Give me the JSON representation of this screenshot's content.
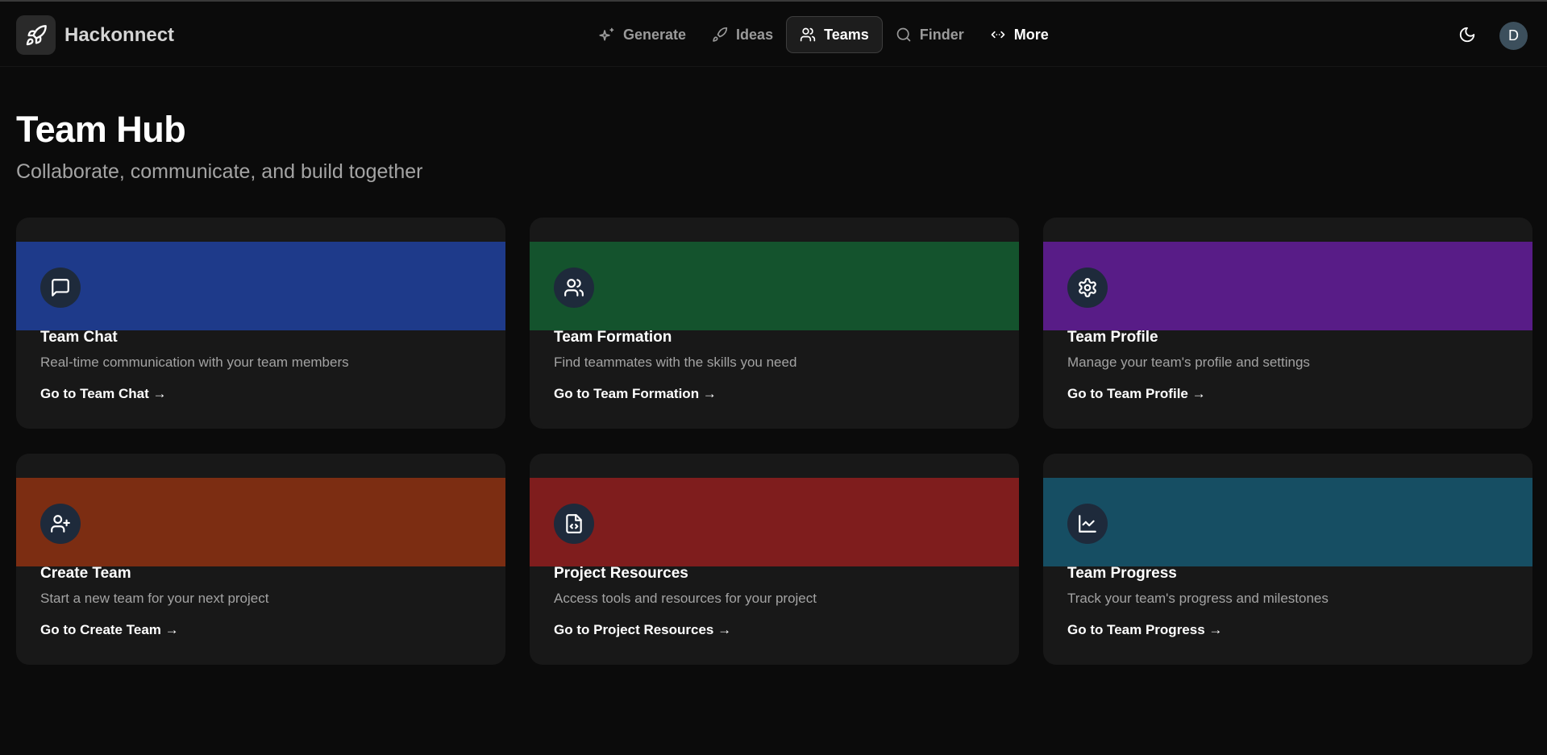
{
  "app": {
    "name": "Hackonnect"
  },
  "nav": {
    "items": [
      {
        "label": "Generate",
        "icon": "sparkles-icon"
      },
      {
        "label": "Ideas",
        "icon": "rocket-icon"
      },
      {
        "label": "Teams",
        "icon": "users-icon",
        "active": true
      },
      {
        "label": "Finder",
        "icon": "search-icon"
      },
      {
        "label": "More",
        "icon": "code-arrows-icon"
      }
    ]
  },
  "header": {
    "theme_icon": "moon-icon",
    "avatar_initial": "D"
  },
  "page": {
    "title": "Team Hub",
    "subtitle": "Collaborate, communicate, and build together"
  },
  "cards": [
    {
      "title": "Team Chat",
      "description": "Real-time communication with your team members",
      "link": "Go to Team Chat →",
      "color": "#1e3a8a",
      "icon": "message-square-icon"
    },
    {
      "title": "Team Formation",
      "description": "Find teammates with the skills you need",
      "link": "Go to Team Formation →",
      "color": "#14532d",
      "icon": "users-icon"
    },
    {
      "title": "Team Profile",
      "description": "Manage your team's profile and settings",
      "link": "Go to Team Profile →",
      "color": "#581c87",
      "icon": "gear-icon"
    },
    {
      "title": "Create Team",
      "description": "Start a new team for your next project",
      "link": "Go to Create Team →",
      "color": "#7c2d12",
      "icon": "user-plus-icon"
    },
    {
      "title": "Project Resources",
      "description": "Access tools and resources for your project",
      "link": "Go to Project Resources →",
      "color": "#7f1d1d",
      "icon": "file-code-icon"
    },
    {
      "title": "Team Progress",
      "description": "Track your team's progress and milestones",
      "link": "Go to Team Progress →",
      "color": "#164e63",
      "icon": "line-chart-icon"
    }
  ]
}
